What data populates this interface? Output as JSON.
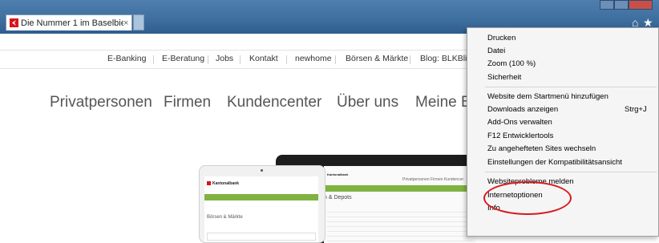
{
  "browser": {
    "tab_title": "Die Nummer 1 im Baselbiet ...",
    "tab_close": "×",
    "home_icon": "home-icon",
    "favorites_icon": "star-icon"
  },
  "topnav": {
    "links": [
      "E-Banking",
      "E-Beratung",
      "Jobs",
      "Kontakt",
      "newhome",
      "Börsen & Märkte",
      "Blog: BLKBlive"
    ]
  },
  "mainnav": {
    "items": [
      "Privatpersonen",
      "Firmen",
      "Kundencenter",
      "Über uns",
      "Meine B"
    ]
  },
  "preview": {
    "tablet_bank": "Kantonalbank",
    "tablet_heading": "Börsen & Märkte",
    "laptop_bank": "Kantonalbank",
    "laptop_heading": "n & Depots",
    "laptop_nav": "Privatpersonen   Firmen   Kundencer"
  },
  "menu": {
    "items": [
      {
        "label": "Drucken"
      },
      {
        "label": "Datei"
      },
      {
        "label": "Zoom (100 %)"
      },
      {
        "label": "Sicherheit"
      },
      {
        "label": "Website dem Startmenü hinzufügen"
      },
      {
        "label": "Downloads anzeigen",
        "shortcut": "Strg+J"
      },
      {
        "label": "Add-Ons verwalten"
      },
      {
        "label": "F12 Entwicklertools"
      },
      {
        "label": "Zu angehefteten Sites wechseln"
      },
      {
        "label": "Einstellungen der Kompatibilitätsansicht"
      },
      {
        "label": "Websiteprobleme melden"
      },
      {
        "label": "Internetoptionen"
      },
      {
        "label": "Info"
      }
    ]
  },
  "colors": {
    "brand": "#d7141a",
    "annotation": "#d7191c"
  }
}
